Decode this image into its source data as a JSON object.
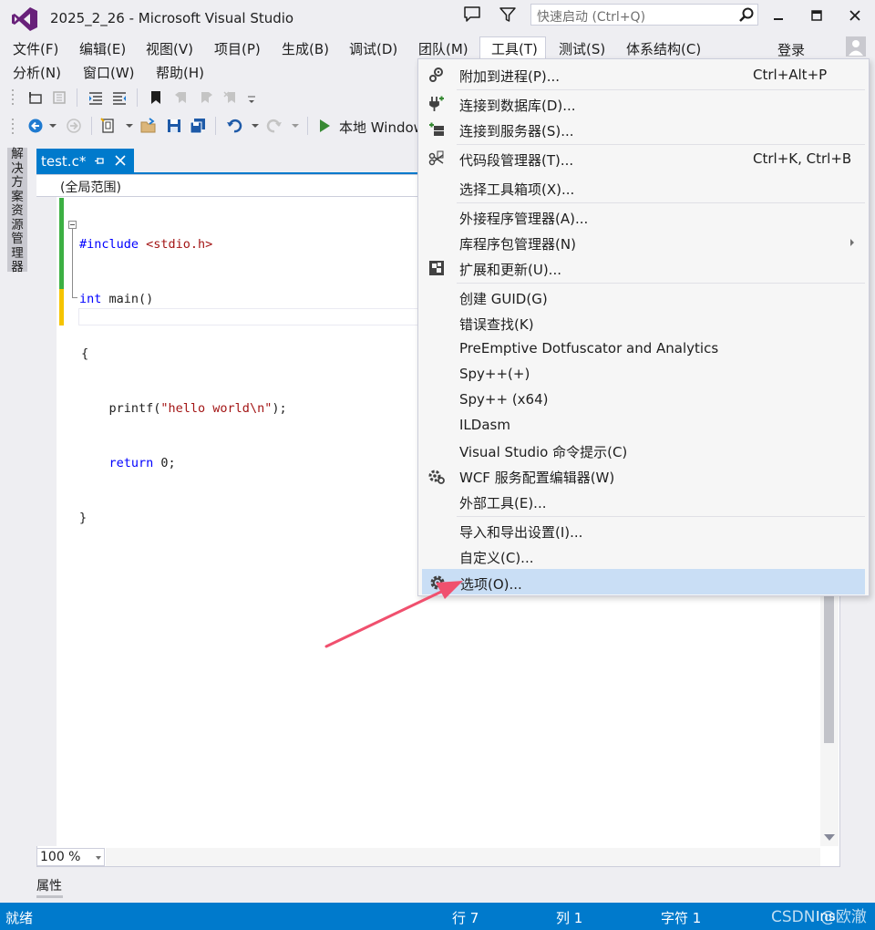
{
  "title": "2025_2_26 - Microsoft Visual Studio",
  "quick_launch": {
    "placeholder": "快速启动 (Ctrl+Q)"
  },
  "menu": {
    "row1": [
      "文件(F)",
      "编辑(E)",
      "视图(V)",
      "项目(P)",
      "生成(B)",
      "调试(D)",
      "团队(M)",
      "工具(T)",
      "测试(S)",
      "体系结构(C)"
    ],
    "row2": [
      "分析(N)",
      "窗口(W)",
      "帮助(H)"
    ],
    "active": "工具(T)"
  },
  "login_label": "登录",
  "toolbar": {
    "run_label": "本地 Windows"
  },
  "side_panel": {
    "label": "解决方案资源管理器"
  },
  "doc_tab": {
    "title": "test.c*"
  },
  "scope": "(全局范围)",
  "code": {
    "line1_directive": "#include",
    "line1_header": " <stdio.h>",
    "line2_kw": "int",
    "line2_rest": " main()",
    "line3": "{",
    "line4_fn": "    printf(",
    "line4_str": "\"hello world\\n\"",
    "line4_end": ");",
    "line5_kw": "    return",
    "line5_rest": " 0;",
    "line6": "}"
  },
  "zoom": "100 %",
  "properties_label": "属性",
  "status": {
    "ready": "就绪",
    "line": "行 7",
    "col": "列 1",
    "char": "字符 1",
    "ins": "Ins"
  },
  "watermark": "CSDN @欧澈",
  "tools_menu": {
    "items": [
      {
        "label": "附加到进程(P)...",
        "shortcut": "Ctrl+Alt+P",
        "icon": "attach-process-icon"
      },
      {
        "label": "连接到数据库(D)...",
        "shortcut": "",
        "icon": "connect-database-icon"
      },
      {
        "label": "连接到服务器(S)...",
        "shortcut": "",
        "icon": "connect-server-icon"
      },
      {
        "label": "代码段管理器(T)...",
        "shortcut": "Ctrl+K, Ctrl+B",
        "icon": "code-snippet-icon"
      },
      {
        "label": "选择工具箱项(X)...",
        "shortcut": "",
        "icon": ""
      },
      {
        "label": "外接程序管理器(A)...",
        "shortcut": "",
        "icon": ""
      },
      {
        "label": "库程序包管理器(N)",
        "shortcut": "",
        "icon": "",
        "submenu": true
      },
      {
        "label": "扩展和更新(U)...",
        "shortcut": "",
        "icon": "extensions-icon"
      },
      {
        "label": "创建 GUID(G)",
        "shortcut": "",
        "icon": ""
      },
      {
        "label": "错误查找(K)",
        "shortcut": "",
        "icon": ""
      },
      {
        "label": "PreEmptive Dotfuscator and Analytics",
        "shortcut": "",
        "icon": ""
      },
      {
        "label": "Spy++(+)",
        "shortcut": "",
        "icon": ""
      },
      {
        "label": "Spy++ (x64)",
        "shortcut": "",
        "icon": ""
      },
      {
        "label": "ILDasm",
        "shortcut": "",
        "icon": ""
      },
      {
        "label": "Visual Studio 命令提示(C)",
        "shortcut": "",
        "icon": ""
      },
      {
        "label": "WCF 服务配置编辑器(W)",
        "shortcut": "",
        "icon": "wcf-config-icon"
      },
      {
        "label": "外部工具(E)...",
        "shortcut": "",
        "icon": ""
      },
      {
        "label": "导入和导出设置(I)...",
        "shortcut": "",
        "icon": ""
      },
      {
        "label": "自定义(C)...",
        "shortcut": "",
        "icon": ""
      },
      {
        "label": "选项(O)...",
        "shortcut": "",
        "icon": "options-gear-icon",
        "highlighted": true
      }
    ]
  },
  "colors": {
    "accent": "#007acc",
    "highlight": "#c9def5",
    "arrow": "#f0506e",
    "vs_purple": "#68217a"
  }
}
